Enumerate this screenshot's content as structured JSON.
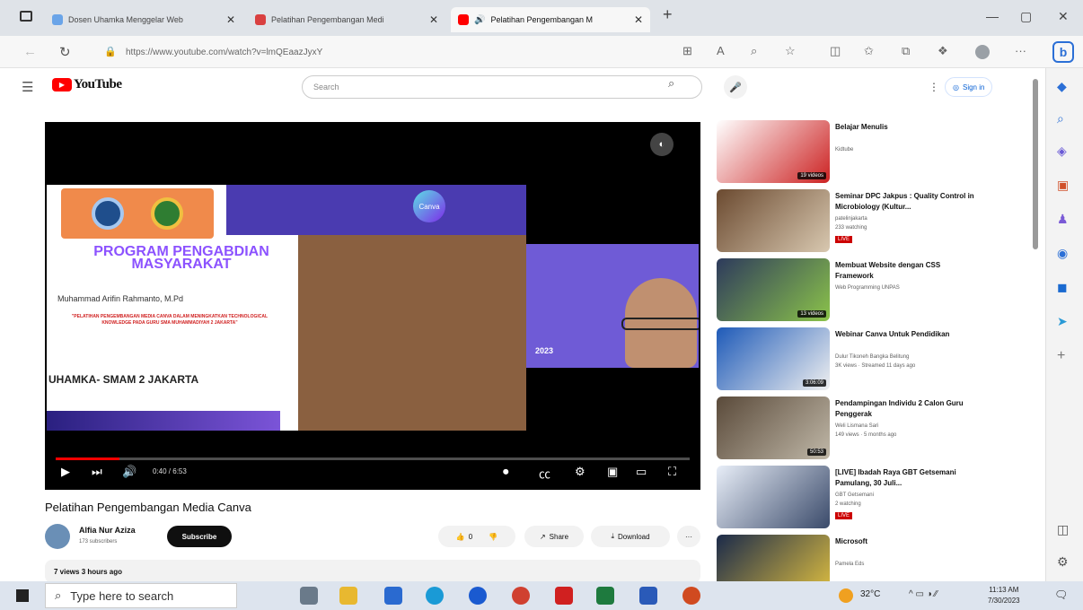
{
  "browser": {
    "tabs": [
      {
        "label": "Dosen Uhamka Menggelar Web"
      },
      {
        "label": "Pelatihan Pengembangan Medi"
      },
      {
        "label": "Pelatihan Pengembangan M"
      }
    ],
    "url": "https://www.youtube.com/watch?v=lmQEaazJyxY"
  },
  "youtube": {
    "logo_text": "YouTube",
    "search_placeholder": "Search",
    "signin_label": "Sign in"
  },
  "video": {
    "slide_title": "PROGRAM PENGABDIAN MASYARAKAT",
    "slide_author": "Muhammad Arifin Rahmanto, M.Pd",
    "slide_theme": "\"PELATIHAN PENGEMBANGAN MEDIA CANVA DALAM MENINGKATKAN TECHNOLOGICAL KNOWLEDGE PADA GURU SMA MUHAMMADIYAH 2 JAKARTA\"",
    "slide_institution": "UHAMKA- SMAM 2 JAKARTA",
    "canva_label": "Canva",
    "cam_year": "2023",
    "timecode": "0:40 / 6:53",
    "progress": 0.1,
    "title": "Pelatihan Pengembangan Media Canva",
    "channel": "Alfia Nur Aziza",
    "subscribers": "173 subscribers",
    "subscribe_label": "Subscribe",
    "likes": "0",
    "share_label": "Share",
    "download_label": "Download",
    "description": "7 views  3 hours ago"
  },
  "recommendations": [
    {
      "title": "Belajar Menulis",
      "channel": "Kidtube",
      "meta": "",
      "badge": "19 videos",
      "live": false,
      "colors": [
        "#ffffff",
        "#cc2222"
      ]
    },
    {
      "title": "Seminar DPC Jakpus : Quality Control in Microbiology (Kultur...",
      "channel": "patelinjakarta",
      "meta": "233 watching",
      "badge": "",
      "live": true,
      "colors": [
        "#6b4a30",
        "#d8c8b0"
      ]
    },
    {
      "title": "Membuat Website dengan CSS Framework",
      "channel": "Web Programming UNPAS",
      "meta": "",
      "badge": "13 videos",
      "live": false,
      "colors": [
        "#2d3a5c",
        "#8bc34a"
      ]
    },
    {
      "title": "Webinar Canva Untuk Pendidikan",
      "channel": "Dulur Tikoneh Bangka Belitung",
      "meta": "3K views · Streamed 11 days ago",
      "badge": "3:06:09",
      "live": false,
      "colors": [
        "#1e5ab8",
        "#f0f0f0"
      ]
    },
    {
      "title": "Pendampingan Individu 2 Calon Guru Penggerak",
      "channel": "Weli Lismana Sari",
      "meta": "149 views · 5 months ago",
      "badge": "50:53",
      "live": false,
      "colors": [
        "#5a4a3a",
        "#c0b8a8"
      ]
    },
    {
      "title": "[LIVE] Ibadah Raya GBT Getsemani Pamulang, 30 Juli...",
      "channel": "GBT Getsemani",
      "meta": "2 watching",
      "badge": "",
      "live": true,
      "colors": [
        "#e8eef8",
        "#3a4a6a"
      ]
    },
    {
      "title": "Microsoft",
      "channel": "Pamela Eds",
      "meta": "",
      "badge": "",
      "live": false,
      "colors": [
        "#1b2a4a",
        "#e0c040"
      ]
    }
  ],
  "live_label": "LIVE",
  "taskbar": {
    "search_placeholder": "Type here to search",
    "temperature": "32°C",
    "time": "11:13 AM",
    "date": "7/30/2023"
  }
}
